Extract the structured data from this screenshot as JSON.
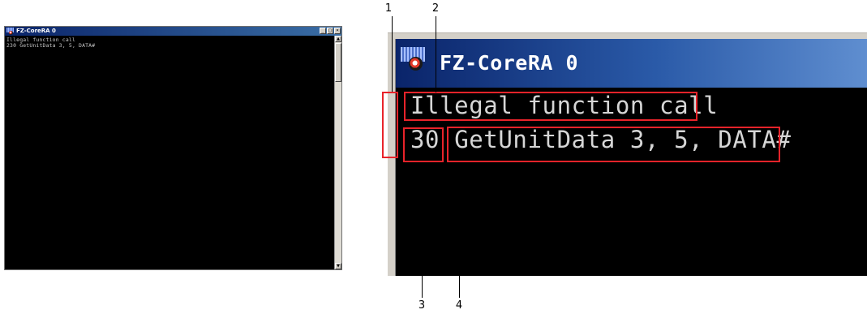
{
  "window": {
    "title": "FZ-CoreRA 0",
    "buttons": {
      "minimize": "_",
      "maximize": "□",
      "close": "×"
    },
    "console_lines": [
      "Illegal function call",
      "230 GetUnitData 3, 5, DATA#"
    ]
  },
  "zoom": {
    "title": "FZ-CoreRA 0",
    "line1": "Illegal function call",
    "line2_number": "230",
    "line2_number_visible": "30",
    "line2_statement": "GetUnitData 3, 5, DATA#"
  },
  "callouts": [
    "1",
    "2",
    "3",
    "4"
  ],
  "colors": {
    "titlebar_start": "#0a246a",
    "titlebar_end": "#5f8ed0",
    "console_bg": "#000000",
    "console_text": "#c8c8c8",
    "highlight": "#e8232a"
  },
  "icons": [
    "app-icon",
    "minimize-icon",
    "maximize-icon",
    "close-icon",
    "scroll-up-icon",
    "scroll-down-icon"
  ]
}
